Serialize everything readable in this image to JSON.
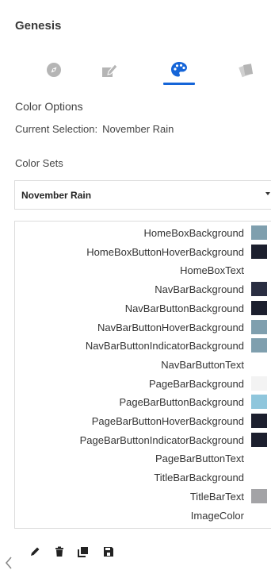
{
  "header": {
    "title": "Genesis"
  },
  "tabs": [
    {
      "icon": "compass-icon",
      "active": false
    },
    {
      "icon": "edit-document-icon",
      "active": false
    },
    {
      "icon": "palette-icon",
      "active": true
    },
    {
      "icon": "cards-icon",
      "active": false
    }
  ],
  "colors": {
    "accent": "#1565d8",
    "inactive_icon": "#b8b8b8"
  },
  "color_options": {
    "heading": "Color Options",
    "current_label": "Current Selection:",
    "current_value": "November Rain"
  },
  "color_sets": {
    "heading": "Color Sets",
    "selected": "November Rain"
  },
  "entries": [
    {
      "name": "HomeBoxBackground",
      "color": "#7f9fae"
    },
    {
      "name": "HomeBoxButtonHoverBackground",
      "color": "#1c1f2e"
    },
    {
      "name": "HomeBoxText",
      "color": null
    },
    {
      "name": "NavBarBackground",
      "color": "#2a2e42"
    },
    {
      "name": "NavBarButtonBackground",
      "color": "#1c1f2e"
    },
    {
      "name": "NavBarButtonHoverBackground",
      "color": "#7f9fae"
    },
    {
      "name": "NavBarButtonIndicatorBackground",
      "color": "#7f9fae"
    },
    {
      "name": "NavBarButtonText",
      "color": null
    },
    {
      "name": "PageBarBackground",
      "color": "#f3f3f3"
    },
    {
      "name": "PageBarButtonBackground",
      "color": "#8fc6dc"
    },
    {
      "name": "PageBarButtonHoverBackground",
      "color": "#1c1f2e"
    },
    {
      "name": "PageBarButtonIndicatorBackground",
      "color": "#1c1f2e"
    },
    {
      "name": "PageBarButtonText",
      "color": null
    },
    {
      "name": "TitleBarBackground",
      "color": null
    },
    {
      "name": "TitleBarText",
      "color": "#a3a3a6"
    },
    {
      "name": "ImageColor",
      "color": null
    }
  ],
  "toolbar": [
    {
      "icon": "pencil-icon"
    },
    {
      "icon": "trash-icon"
    },
    {
      "icon": "copy-icon"
    },
    {
      "icon": "save-icon"
    }
  ],
  "collapse_icon": "chevron-left-icon"
}
